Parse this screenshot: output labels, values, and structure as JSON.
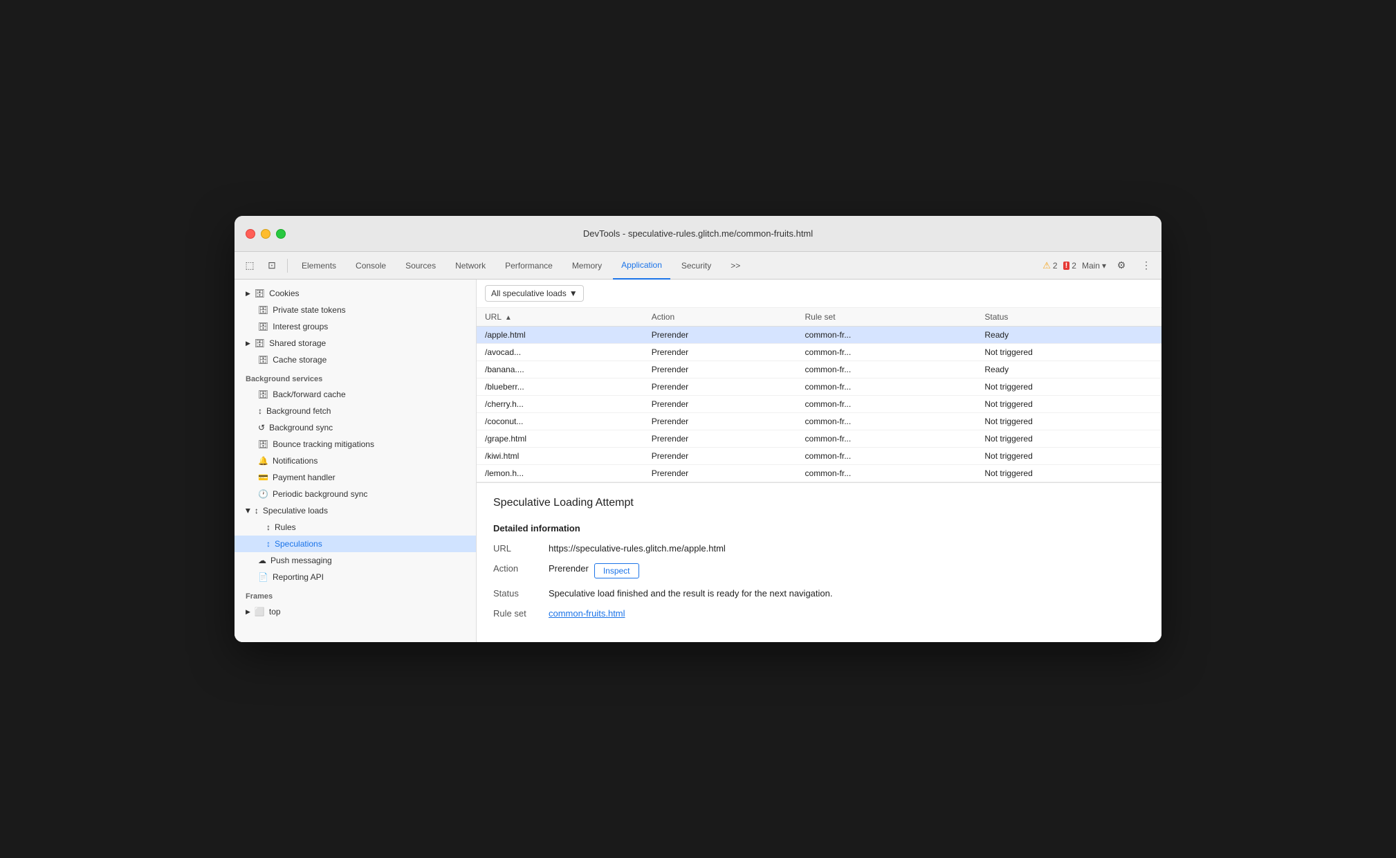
{
  "window": {
    "title": "DevTools - speculative-rules.glitch.me/common-fruits.html"
  },
  "toolbar": {
    "tabs": [
      {
        "label": "Elements",
        "active": false
      },
      {
        "label": "Console",
        "active": false
      },
      {
        "label": "Sources",
        "active": false
      },
      {
        "label": "Network",
        "active": false
      },
      {
        "label": "Performance",
        "active": false
      },
      {
        "label": "Memory",
        "active": false
      },
      {
        "label": "Application",
        "active": true
      },
      {
        "label": "Security",
        "active": false
      }
    ],
    "more_tabs": ">>",
    "warning_count": "2",
    "error_count": "2",
    "main_label": "Main",
    "settings_icon": "⚙",
    "more_icon": "⋮"
  },
  "sidebar": {
    "storage_items": [
      {
        "label": "Cookies",
        "icon": "▶",
        "indent": 0,
        "has_db": true
      },
      {
        "label": "Private state tokens",
        "icon": "",
        "indent": 0,
        "has_db": true
      },
      {
        "label": "Interest groups",
        "icon": "",
        "indent": 0,
        "has_db": true
      },
      {
        "label": "Shared storage",
        "icon": "▶",
        "indent": 0,
        "has_db": true
      },
      {
        "label": "Cache storage",
        "icon": "",
        "indent": 0,
        "has_db": true
      }
    ],
    "bg_services_label": "Background services",
    "bg_services": [
      {
        "label": "Back/forward cache",
        "has_db": true
      },
      {
        "label": "Background fetch",
        "has_arrow": true
      },
      {
        "label": "Background sync",
        "has_arrow": true
      },
      {
        "label": "Bounce tracking mitigations",
        "has_db": true
      },
      {
        "label": "Notifications",
        "has_bell": true
      },
      {
        "label": "Payment handler",
        "has_card": true
      },
      {
        "label": "Periodic background sync",
        "has_clock": true
      },
      {
        "label": "Speculative loads",
        "expanded": true,
        "has_arrow": true,
        "arrow_down": true
      },
      {
        "label": "Rules",
        "indent": true,
        "has_arrow": true
      },
      {
        "label": "Speculations",
        "indent": true,
        "has_arrow": true,
        "active": true
      },
      {
        "label": "Push messaging",
        "has_cloud": true
      },
      {
        "label": "Reporting API",
        "has_file": true
      }
    ],
    "frames_label": "Frames",
    "frames": [
      {
        "label": "top",
        "icon": "▶"
      }
    ]
  },
  "filter": {
    "label": "All speculative loads",
    "dropdown_icon": "▼"
  },
  "table": {
    "headers": [
      {
        "label": "URL",
        "sort": true
      },
      {
        "label": "Action"
      },
      {
        "label": "Rule set"
      },
      {
        "label": "Status"
      }
    ],
    "rows": [
      {
        "url": "/apple.html",
        "action": "Prerender",
        "rule_set": "common-fr...",
        "status": "Ready",
        "selected": true
      },
      {
        "url": "/avocad...",
        "action": "Prerender",
        "rule_set": "common-fr...",
        "status": "Not triggered",
        "selected": false
      },
      {
        "url": "/banana....",
        "action": "Prerender",
        "rule_set": "common-fr...",
        "status": "Ready",
        "selected": false
      },
      {
        "url": "/blueberr...",
        "action": "Prerender",
        "rule_set": "common-fr...",
        "status": "Not triggered",
        "selected": false
      },
      {
        "url": "/cherry.h...",
        "action": "Prerender",
        "rule_set": "common-fr...",
        "status": "Not triggered",
        "selected": false
      },
      {
        "url": "/coconut...",
        "action": "Prerender",
        "rule_set": "common-fr...",
        "status": "Not triggered",
        "selected": false
      },
      {
        "url": "/grape.html",
        "action": "Prerender",
        "rule_set": "common-fr...",
        "status": "Not triggered",
        "selected": false
      },
      {
        "url": "/kiwi.html",
        "action": "Prerender",
        "rule_set": "common-fr...",
        "status": "Not triggered",
        "selected": false
      },
      {
        "url": "/lemon.h...",
        "action": "Prerender",
        "rule_set": "common-fr...",
        "status": "Not triggered",
        "selected": false
      }
    ]
  },
  "detail": {
    "title": "Speculative Loading Attempt",
    "section_title": "Detailed information",
    "url_label": "URL",
    "url_value": "https://speculative-rules.glitch.me/apple.html",
    "action_label": "Action",
    "action_value": "Prerender",
    "inspect_button": "Inspect",
    "status_label": "Status",
    "status_value": "Speculative load finished and the result is ready for the next navigation.",
    "rule_set_label": "Rule set",
    "rule_set_value": "common-fruits.html"
  }
}
